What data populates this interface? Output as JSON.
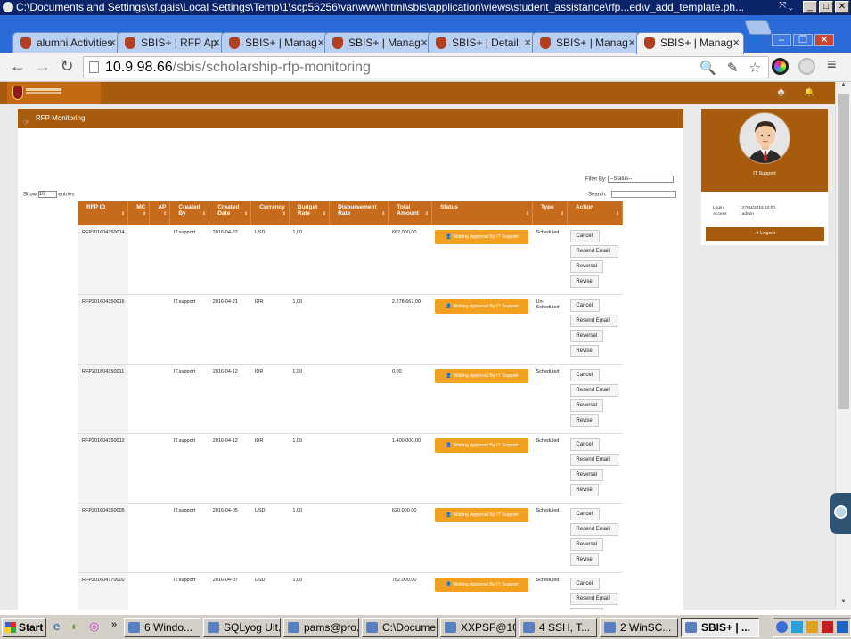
{
  "window": {
    "title": "C:\\Documents and Settings\\sf.gais\\Local Settings\\Temp\\1\\scp56256\\var\\www\\html\\sbis\\application\\views\\student_assistance\\rfp...ed\\v_add_template.ph...",
    "min": "_",
    "max": "□",
    "close": "✕",
    "overlay": "⤧ ⌄"
  },
  "tabs": [
    {
      "label": "alumni Activities",
      "close": "×"
    },
    {
      "label": "SBIS+ | RFP Ap",
      "close": "×"
    },
    {
      "label": "SBIS+ | Manag",
      "close": "×"
    },
    {
      "label": "SBIS+ | Manag",
      "close": "×"
    },
    {
      "label": "SBIS+ | Detail",
      "close": "×"
    },
    {
      "label": "SBIS+ | Manag",
      "close": "×"
    },
    {
      "label": "SBIS+ | Manag",
      "close": "×"
    }
  ],
  "toolbar": {
    "back": "←",
    "forward": "→",
    "reload": "↻",
    "url_host": "10.9.98.66",
    "url_path": "/sbis/scholarship-rfp-monitoring",
    "right_icons": "🔍 ✎ ☆",
    "menu": "≡"
  },
  "app": {
    "header_icons": "🏠 🔔"
  },
  "panel": {
    "title": "RFP Monitoring",
    "title_icon": "☞"
  },
  "controls": {
    "filter_label": "Filter By:",
    "filter_value": "--Status--",
    "search_label": "Search:",
    "show_label": "Show",
    "show_value": "10",
    "entries_label": "entries"
  },
  "table": {
    "columns": [
      "RFP ID",
      "MC",
      "AP",
      "Created By",
      "Created Date",
      "Currency",
      "Budget Rate",
      "Disbursement Rate",
      "Total Amount",
      "Status",
      "Type",
      "Action"
    ],
    "rows": [
      {
        "id": "RFP201604150014",
        "mc": "",
        "ap": "",
        "by": "IT.support",
        "date": "2016-04-22",
        "cur": "USD",
        "budget": "1,00",
        "disb": "",
        "total": "662.000,00",
        "status": "Waiting Approval By IT Support",
        "type": "Scheduled"
      },
      {
        "id": "RFP201604150016",
        "mc": "",
        "ap": "",
        "by": "IT.support",
        "date": "2016-04-21",
        "cur": "IDR",
        "budget": "1,00",
        "disb": "",
        "total": "2.278.667,00",
        "status": "Waiting Approval By IT Support",
        "type": "Un-Scheduled"
      },
      {
        "id": "RFP201604150011",
        "mc": "",
        "ap": "",
        "by": "IT.support",
        "date": "2016-04-12",
        "cur": "IDR",
        "budget": "1,00",
        "disb": "",
        "total": "0,00",
        "status": "Waiting Approval By IT Support",
        "type": "Scheduled"
      },
      {
        "id": "RFP201604150012",
        "mc": "",
        "ap": "",
        "by": "IT.support",
        "date": "2016-04-12",
        "cur": "IDR",
        "budget": "1,00",
        "disb": "",
        "total": "1.400.000,00",
        "status": "Waiting Approval By IT Support",
        "type": "Scheduled"
      },
      {
        "id": "RFP201604150005",
        "mc": "",
        "ap": "",
        "by": "IT.support",
        "date": "2016-04-05",
        "cur": "USD",
        "budget": "1,00",
        "disb": "",
        "total": "620.000,00",
        "status": "Waiting Approval By IT Support",
        "type": "Scheduled"
      },
      {
        "id": "RFP201604170002",
        "mc": "",
        "ap": "",
        "by": "IT.support",
        "date": "2016-04-07",
        "cur": "USD",
        "budget": "1,00",
        "disb": "",
        "total": "782.000,00",
        "status": "Waiting Approval By IT Support",
        "type": "Scheduled"
      }
    ],
    "actions": [
      "Cancel",
      "Resend Email",
      "Reversal",
      "Revise"
    ]
  },
  "side": {
    "role": "IT Support",
    "login_label": "Login",
    "login_value": ": 27/04/2016 10:00",
    "access_label": "Access",
    "access_value": ": admin",
    "logout": "Logout"
  },
  "taskbar": {
    "start": "Start",
    "buttons": [
      "6 Windo...",
      "SQLyog Ult...",
      "pams@pro...",
      "C:\\Docume...",
      "XXPSF@10...",
      "4 SSH, T...",
      "2 WinSC...",
      "SBIS+ | ..."
    ]
  }
}
